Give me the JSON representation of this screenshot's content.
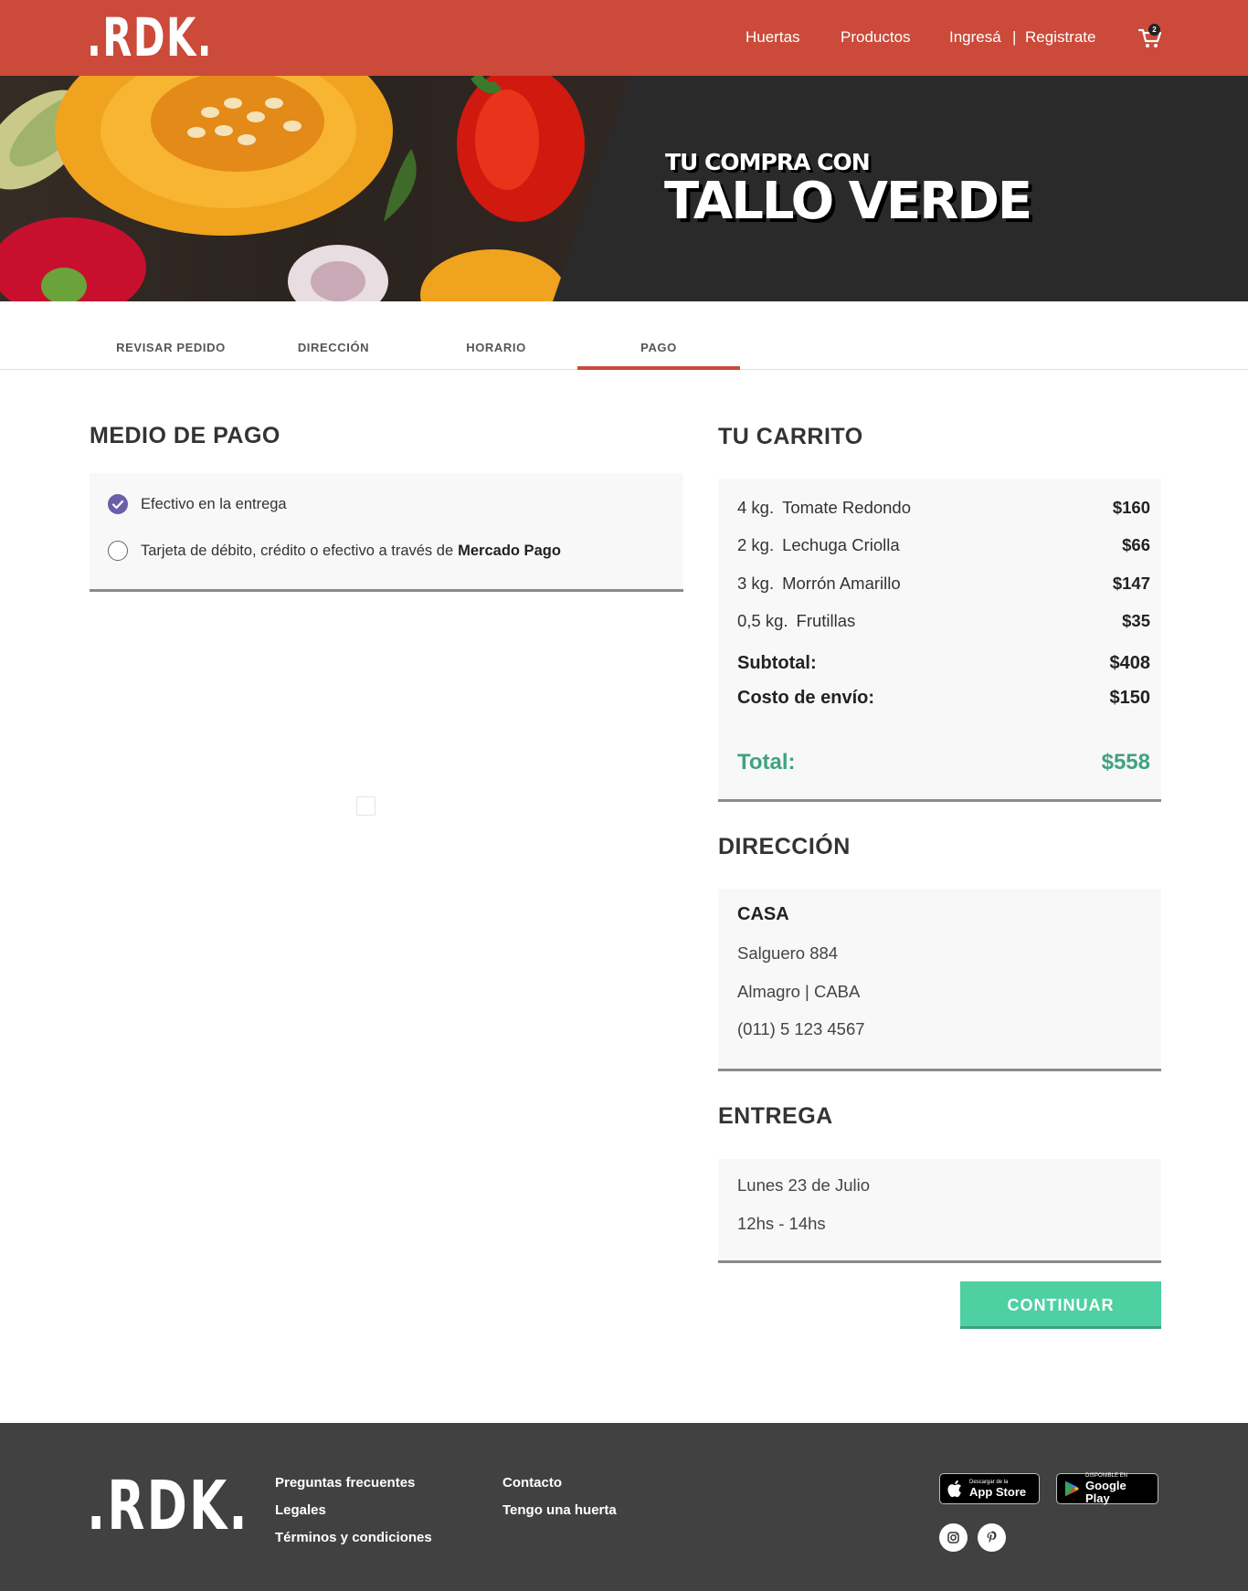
{
  "header": {
    "logo": ".RDK.",
    "nav": {
      "huertas": "Huertas",
      "productos": "Productos",
      "ingresa": "Ingresá",
      "separator": "|",
      "registrate": "Registrate"
    },
    "cart_count": "2"
  },
  "hero": {
    "line1": "TU COMPRA CON",
    "line2": "TALLO VERDE"
  },
  "steps": [
    "REVISAR PEDIDO",
    "DIRECCIÓN",
    "HORARIO",
    "PAGO"
  ],
  "active_step": "PAGO",
  "payment": {
    "title": "MEDIO DE PAGO",
    "options": [
      {
        "label": "Efectivo en la entrega",
        "selected": true
      },
      {
        "label": "Tarjeta de débito, crédito o efectivo a través de",
        "strong": "Mercado Pago",
        "selected": false
      }
    ]
  },
  "cart": {
    "title": "TU CARRITO",
    "items": [
      {
        "qty": "4 kg.",
        "name": "Tomate Redondo",
        "price": "$160"
      },
      {
        "qty": "2 kg.",
        "name": "Lechuga Criolla",
        "price": "$66"
      },
      {
        "qty": "3 kg.",
        "name": "Morrón Amarillo",
        "price": "$147"
      },
      {
        "qty": "0,5 kg.",
        "name": "Frutillas",
        "price": "$35"
      }
    ],
    "subtotal_label": "Subtotal:",
    "subtotal": "$408",
    "shipping_label": "Costo de envío:",
    "shipping": "$150",
    "total_label": "Total:",
    "total": "$558"
  },
  "address": {
    "title": "DIRECCIÓN",
    "name": "CASA",
    "street": "Salguero 884",
    "area": "Almagro  |  CABA",
    "phone": "(011) 5 123 4567"
  },
  "delivery": {
    "title": "ENTREGA",
    "date": "Lunes 23 de Julio",
    "time": "12hs - 14hs"
  },
  "continue_label": "CONTINUAR",
  "footer": {
    "logo": ".RDK.",
    "links_col1": [
      "Preguntas frecuentes",
      "Legales",
      "Términos y condiciones"
    ],
    "links_col2": [
      "Contacto",
      "Tengo una huerta"
    ],
    "appstore_small": "Descargar de la",
    "appstore_big": "App Store",
    "googleplay_small": "DISPONIBLE EN",
    "googleplay_big": "Google Play"
  },
  "colors": {
    "brand_red": "#cb4a3a",
    "accent_green": "#4fd0a2",
    "total_green": "#3fa37e",
    "radio_purple": "#6a5fa8",
    "footer_bg": "#414141"
  },
  "icons": [
    "cart-icon",
    "check-icon",
    "apple-icon",
    "google-play-icon",
    "instagram-icon",
    "pinterest-icon"
  ]
}
